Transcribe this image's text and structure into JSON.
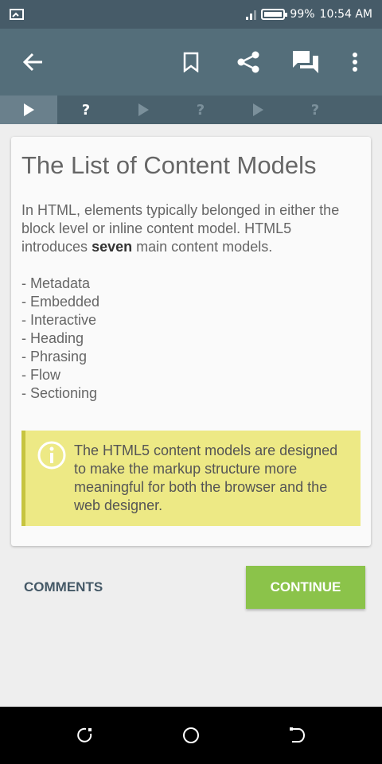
{
  "status_bar": {
    "battery_percent": "99%",
    "time": "10:54 AM"
  },
  "app_bar": {
    "icons": [
      "back-arrow-icon",
      "bookmark-icon",
      "share-icon",
      "chat-icon",
      "more-vertical-icon"
    ]
  },
  "progress": {
    "steps": [
      {
        "kind": "play",
        "active": true
      },
      {
        "kind": "question",
        "text": "?",
        "active": false
      },
      {
        "kind": "play",
        "active": false
      },
      {
        "kind": "question",
        "text": "?",
        "active": false
      },
      {
        "kind": "play",
        "active": false
      },
      {
        "kind": "question",
        "text": "?",
        "active": false
      }
    ]
  },
  "lesson": {
    "title": "The List of Content Models",
    "intro_before": "In HTML, elements typically belonged in either the block level or inline content model. HTML5 introduces ",
    "intro_bold": "seven",
    "intro_after": " main content models.",
    "items": [
      "- Metadata",
      "- Embedded",
      "- Interactive",
      "- Heading",
      "- Phrasing",
      "- Flow",
      "- Sectioning"
    ],
    "note": "The HTML5 content models are designed to make the markup structure more meaningful for both the browser and the web designer."
  },
  "actions": {
    "comments_label": "COMMENTS",
    "continue_label": "CONTINUE"
  },
  "colors": {
    "app_bar": "#546e7a",
    "status_bar": "#465b68",
    "accent_green": "#8bc34a",
    "note_bg": "#ede985"
  }
}
